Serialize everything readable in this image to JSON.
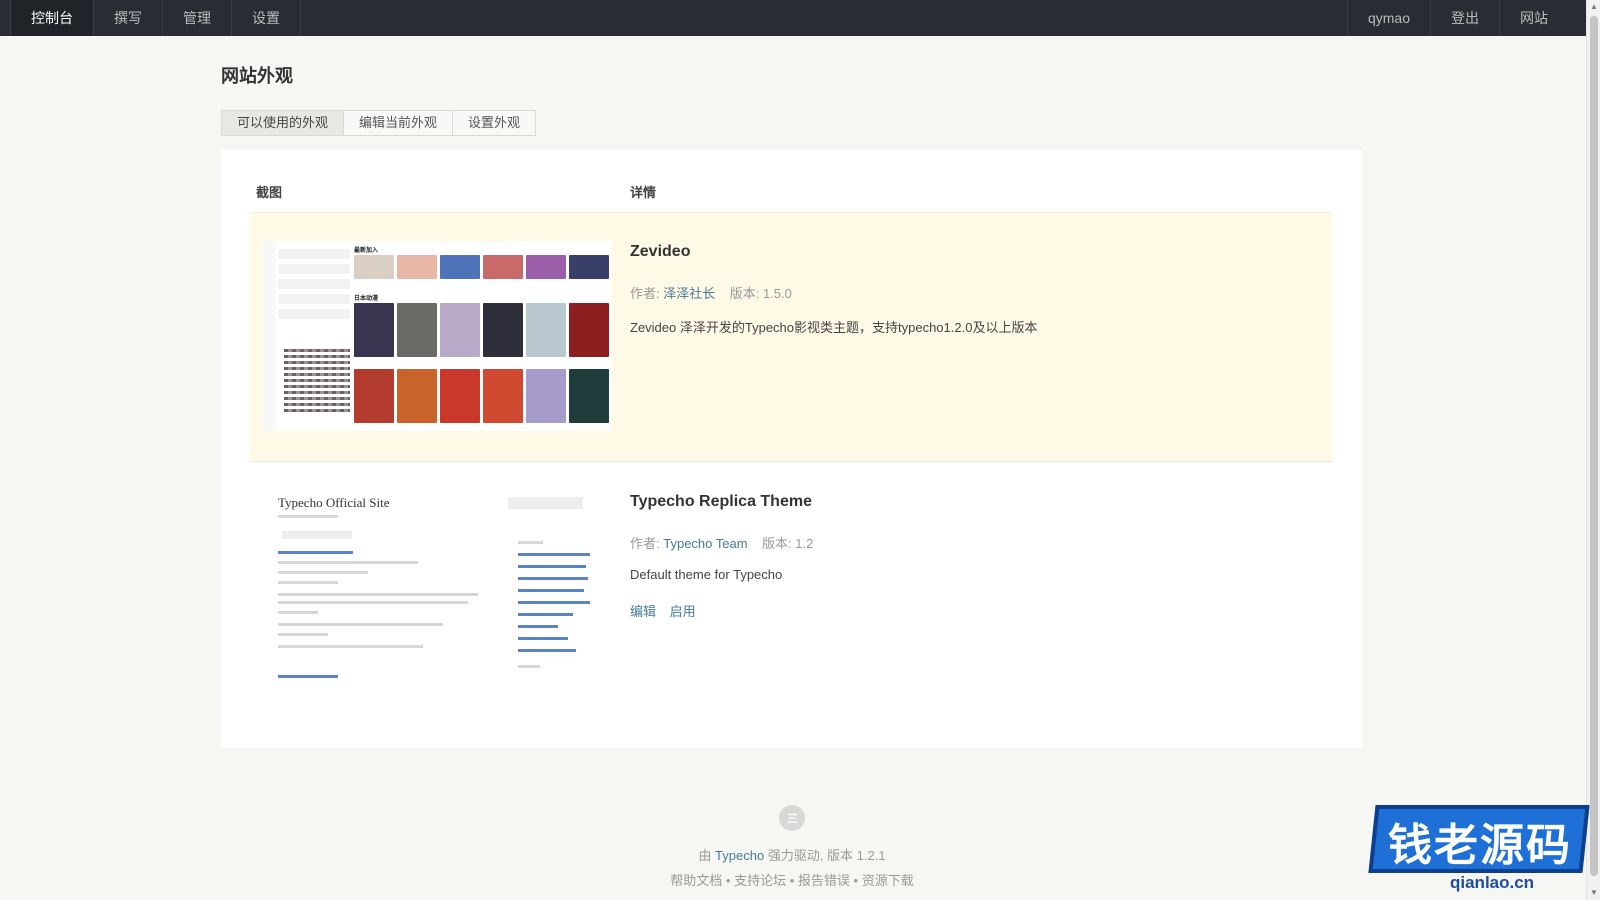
{
  "nav": {
    "left": [
      "控制台",
      "撰写",
      "管理",
      "设置"
    ],
    "right": [
      "qymao",
      "登出",
      "网站"
    ]
  },
  "page": {
    "title": "网站外观"
  },
  "tabs": [
    {
      "label": "可以使用的外观",
      "active": true
    },
    {
      "label": "编辑当前外观",
      "active": false
    },
    {
      "label": "设置外观",
      "active": false
    }
  ],
  "table": {
    "headers": {
      "screenshot": "截图",
      "details": "详情"
    },
    "rows": [
      {
        "name": "Zevideo",
        "author_label": "作者:",
        "author": "泽泽社长",
        "version_label": "版本:",
        "version": "1.5.0",
        "description": "Zevideo 泽泽开发的Typecho影视类主题，支持typecho1.2.0及以上版本",
        "current": true,
        "screenshot": {
          "section1": "最新加入",
          "section2": "日本动漫"
        }
      },
      {
        "name": "Typecho Replica Theme",
        "author_label": "作者:",
        "author": "Typecho Team",
        "version_label": "版本:",
        "version": "1.2",
        "description": "Default theme for Typecho",
        "current": false,
        "actions": {
          "edit": "编辑",
          "activate": "启用"
        },
        "screenshot": {
          "site_title": "Typecho Official Site"
        }
      }
    ]
  },
  "footer": {
    "logo_glyph": "三",
    "powered_prefix": "由",
    "powered_brand": "Typecho",
    "powered_suffix": "强力驱动, 版本 1.2.1",
    "links": [
      "帮助文档",
      "支持论坛",
      "报告错误",
      "资源下载"
    ],
    "separator": "•"
  },
  "watermark": {
    "text": "钱老源码",
    "url": "qianlao.cn"
  },
  "colors": {
    "nav_bg": "#292d33",
    "link": "#467b96",
    "current_row": "#fff9e6",
    "page_bg": "#f6f6f3"
  }
}
